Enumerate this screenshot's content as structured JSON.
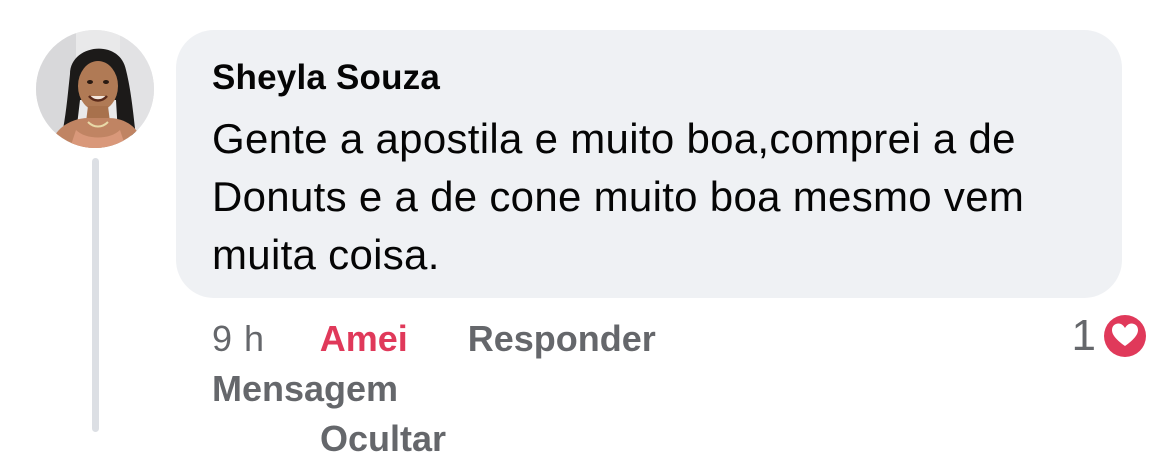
{
  "comment": {
    "author": "Sheyla Souza",
    "text_lines": [
      "Gente a apostila e muito boa,comprei a de",
      "Donuts e a de cone muito boa mesmo vem",
      "muita coisa."
    ]
  },
  "actions": {
    "time": "9 h",
    "love": "Amei",
    "reply": "Responder",
    "message": "Mensagem",
    "hide": "Ocultar"
  },
  "reactions": {
    "count": "1",
    "icon": "heart-icon",
    "color": "#e0395a"
  },
  "colors": {
    "bubble": "#eff1f4",
    "secondary_text": "#65676b",
    "loved_action": "#e0395a"
  }
}
